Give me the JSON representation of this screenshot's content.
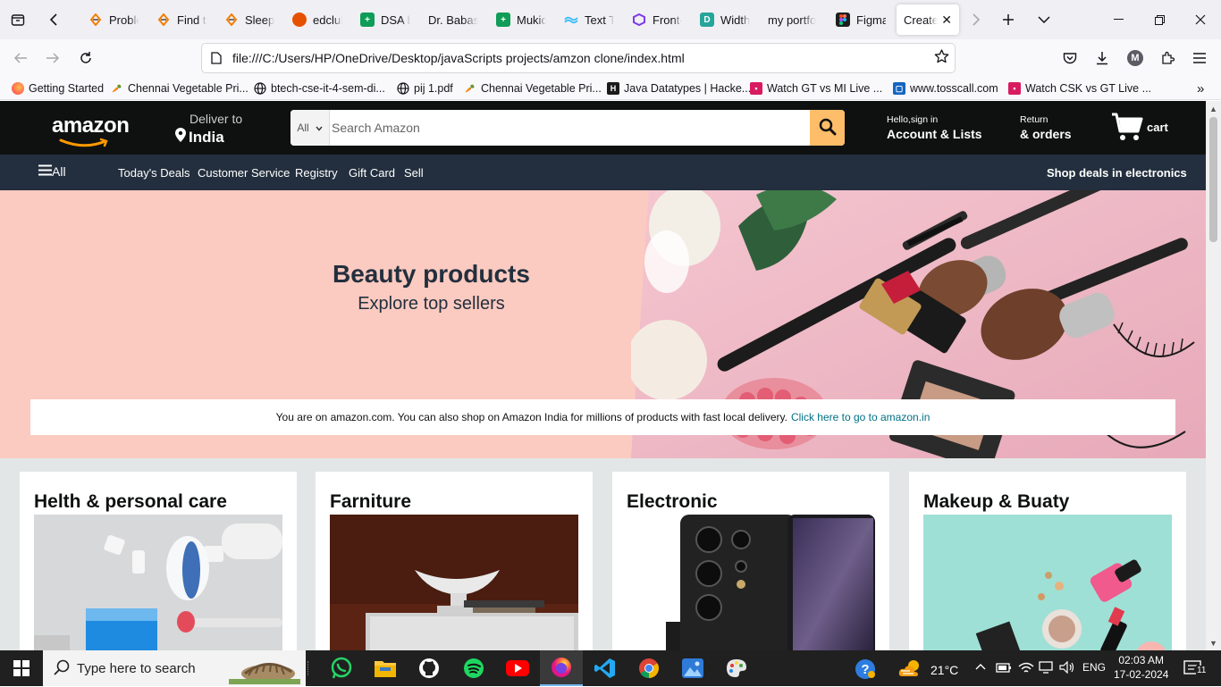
{
  "browser": {
    "tabs": [
      {
        "label": "Proble",
        "icon": "codingninjas-icon",
        "color": "#f57c00"
      },
      {
        "label": "Find tl",
        "icon": "codingninjas-icon",
        "color": "#f57c00"
      },
      {
        "label": "Sleep",
        "icon": "codingninjas-icon",
        "color": "#f57c00"
      },
      {
        "label": "edclub",
        "icon": "edclub-icon",
        "color": "#e65100"
      },
      {
        "label": "DSA b",
        "icon": "sheets-icon",
        "color": "#0f9d58"
      },
      {
        "label": "Dr. Babasa",
        "icon": "blank-icon",
        "color": "#f0f0f4"
      },
      {
        "label": "Mukid",
        "icon": "sheets-icon",
        "color": "#0f9d58"
      },
      {
        "label": "Text Tr",
        "icon": "tailwind-icon",
        "color": "#38bdf8"
      },
      {
        "label": "Front-",
        "icon": "frontend-icon",
        "color": "#7c3aed"
      },
      {
        "label": "Width",
        "icon": "devtools-icon",
        "color": "#26a69a"
      },
      {
        "label": "my portfo",
        "icon": "blank-icon",
        "color": "#f0f0f4"
      },
      {
        "label": "Figma",
        "icon": "figma-icon",
        "color": "#1e1e1e"
      },
      {
        "label": "Created",
        "icon": "none",
        "color": "#ffffff"
      }
    ],
    "url": "file:///C:/Users/HP/OneDrive/Desktop/javaScripts projects/amzon clone/index.html",
    "account_initial": "M",
    "bookmarks": [
      {
        "label": "Getting Started",
        "icon": "firefox-icon"
      },
      {
        "label": "Chennai Vegetable Pri...",
        "icon": "vegetable-icon"
      },
      {
        "label": "btech-cse-it-4-sem-di...",
        "icon": "globe-icon"
      },
      {
        "label": "pij 1.pdf",
        "icon": "globe-icon"
      },
      {
        "label": "Chennai Vegetable Pri...",
        "icon": "vegetable-icon"
      },
      {
        "label": "Java Datatypes | Hacke...",
        "icon": "hackerrank-icon"
      },
      {
        "label": "Watch GT vs MI Live ...",
        "icon": "hotstar-icon"
      },
      {
        "label": "www.tosscall.com",
        "icon": "tosscall-icon"
      },
      {
        "label": "Watch CSK vs GT Live ...",
        "icon": "hotstar-icon"
      }
    ]
  },
  "amazon": {
    "logo": "amazon",
    "deliver_to": "Deliver to",
    "location": "India",
    "search_category": "All",
    "search_placeholder": "Search Amazon",
    "hello": "Hello,sign in",
    "account": "Account & Lists",
    "returns": "Return",
    "orders": "& orders",
    "cart": "cart",
    "subnav": {
      "all": "All",
      "items": [
        "Today's Deals",
        "Customer Service",
        "Registry",
        "Gift Card",
        "Sell"
      ],
      "deal": "Shop deals in electronics"
    },
    "hero": {
      "title": "Beauty products",
      "subtitle": "Explore top sellers"
    },
    "notice": {
      "text": "You are on amazon.com. You can also shop on Amazon India for millions of products with fast local delivery.",
      "link": "Click here to go to amazon.in"
    },
    "cards": [
      {
        "title": "Helth & personal care"
      },
      {
        "title": "Farniture"
      },
      {
        "title": "Electronic"
      },
      {
        "title": "Makeup & Buaty"
      }
    ]
  },
  "taskbar": {
    "search_placeholder": "Type here to search",
    "apps": [
      "whatsapp-icon",
      "file-explorer-icon",
      "github-icon",
      "spotify-icon",
      "youtube-icon",
      "firefox-icon",
      "vscode-icon",
      "chrome-icon",
      "photos-icon",
      "paint-icon"
    ],
    "weather": "21°C",
    "language": "ENG",
    "time": "02:03 AM",
    "date": "17-02-2024",
    "notifications": "11"
  },
  "colors": {
    "amazon_nav": "#0f1111",
    "amazon_subnav": "#232f3e",
    "search_button": "#febd69",
    "hero_bg": "#fbcac0",
    "link": "#007185",
    "page_bg": "#e3e6e6"
  }
}
